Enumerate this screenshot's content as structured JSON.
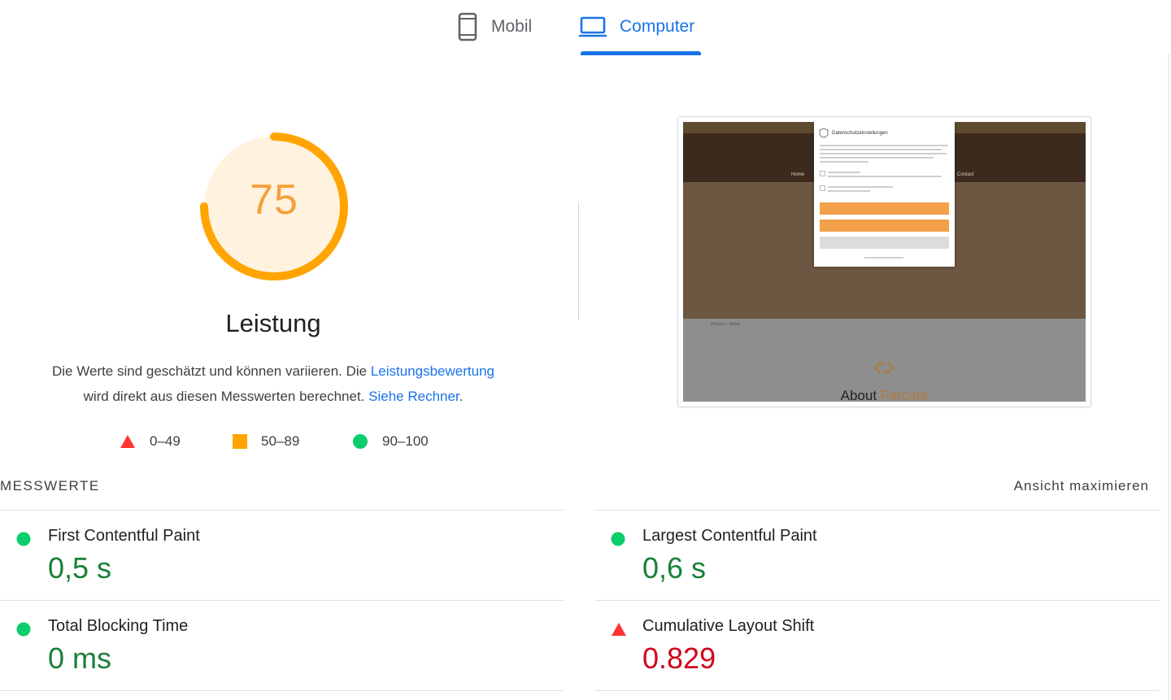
{
  "tabs": [
    {
      "label": "Mobil",
      "icon": "phone-icon",
      "active": false
    },
    {
      "label": "Computer",
      "icon": "laptop-icon",
      "active": true
    }
  ],
  "score": {
    "value": "75",
    "fraction": 0.75,
    "color": "#ffa400",
    "bg": "#fff3e0"
  },
  "performance": {
    "title": "Leistung",
    "desc_part1": "Die Werte sind geschätzt und können variieren. Die ",
    "desc_link1": "Leistungsbewertung",
    "desc_part2": "wird direkt aus diesen Messwerten berechnet. ",
    "desc_link2": "Siehe Rechner",
    "desc_part3": "."
  },
  "legend": [
    {
      "range": "0–49",
      "shape": "triangle-icon",
      "color": "#ff3333"
    },
    {
      "range": "50–89",
      "shape": "square-icon",
      "color": "#ffa400"
    },
    {
      "range": "90–100",
      "shape": "circle-icon",
      "color": "#0cce6b"
    }
  ],
  "screenshot": {
    "modal_title": "Datenschutzeinstellungen",
    "nav_home": "Home",
    "nav_contact": "Contact",
    "breadcrumb": "Petcare > About",
    "heading_part1": "About ",
    "heading_part2": "Petcare"
  },
  "metrics_label": "MESSWERTE",
  "maximize_label": "Ansicht maximieren",
  "metrics": [
    {
      "name": "First Contentful Paint",
      "value": "0,5 s",
      "status": "good"
    },
    {
      "name": "Largest Contentful Paint",
      "value": "0,6 s",
      "status": "good"
    },
    {
      "name": "Total Blocking Time",
      "value": "0 ms",
      "status": "good"
    },
    {
      "name": "Cumulative Layout Shift",
      "value": "0.829",
      "status": "bad"
    }
  ]
}
